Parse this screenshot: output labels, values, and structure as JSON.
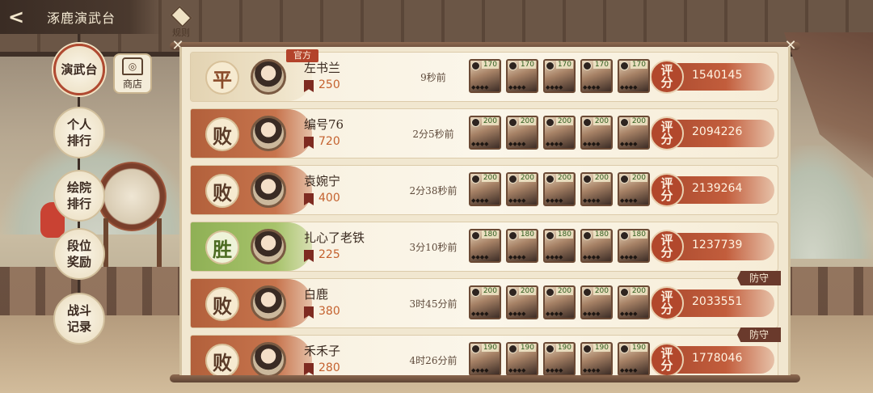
{
  "header": {
    "back_label": "<",
    "title": "涿鹿演武台"
  },
  "rules": {
    "label": "规则"
  },
  "shop": {
    "label": "商店"
  },
  "nav": [
    {
      "label_line1": "演武台",
      "label_line2": "",
      "active": true
    },
    {
      "label_line1": "个人",
      "label_line2": "排行",
      "active": false
    },
    {
      "label_line1": "绘院",
      "label_line2": "排行",
      "active": false
    },
    {
      "label_line1": "段位",
      "label_line2": "奖励",
      "active": false
    },
    {
      "label_line1": "战斗",
      "label_line2": "记录",
      "active": false
    }
  ],
  "rating_label_line1": "评",
  "rating_label_line2": "分",
  "records": [
    {
      "result": "平",
      "result_type": "draw",
      "official": "官方",
      "name": "左书兰",
      "score": "250",
      "time": "9秒前",
      "rating": "1540145",
      "defend": "",
      "hero_levels": [
        "170",
        "170",
        "170",
        "170",
        "170"
      ]
    },
    {
      "result": "败",
      "result_type": "lose",
      "official": "",
      "name": "编号76",
      "score": "720",
      "time": "2分5秒前",
      "rating": "2094226",
      "defend": "",
      "hero_levels": [
        "200",
        "200",
        "200",
        "200",
        "200"
      ]
    },
    {
      "result": "败",
      "result_type": "lose",
      "official": "",
      "name": "袁婉宁",
      "score": "400",
      "time": "2分38秒前",
      "rating": "2139264",
      "defend": "",
      "hero_levels": [
        "200",
        "200",
        "200",
        "200",
        "200"
      ]
    },
    {
      "result": "胜",
      "result_type": "win",
      "official": "",
      "name": "扎心了老铁",
      "score": "225",
      "time": "3分10秒前",
      "rating": "1237739",
      "defend": "",
      "hero_levels": [
        "180",
        "180",
        "180",
        "180",
        "180"
      ]
    },
    {
      "result": "败",
      "result_type": "lose",
      "official": "",
      "name": "白鹿",
      "score": "380",
      "time": "3时45分前",
      "rating": "2033551",
      "defend": "防守",
      "hero_levels": [
        "200",
        "200",
        "200",
        "200",
        "200"
      ]
    },
    {
      "result": "败",
      "result_type": "lose",
      "official": "",
      "name": "禾禾子",
      "score": "280",
      "time": "4时26分前",
      "rating": "1778046",
      "defend": "防守",
      "hero_levels": [
        "190",
        "190",
        "190",
        "190",
        "190"
      ]
    }
  ],
  "hero_stars": "◆◆◆◆"
}
